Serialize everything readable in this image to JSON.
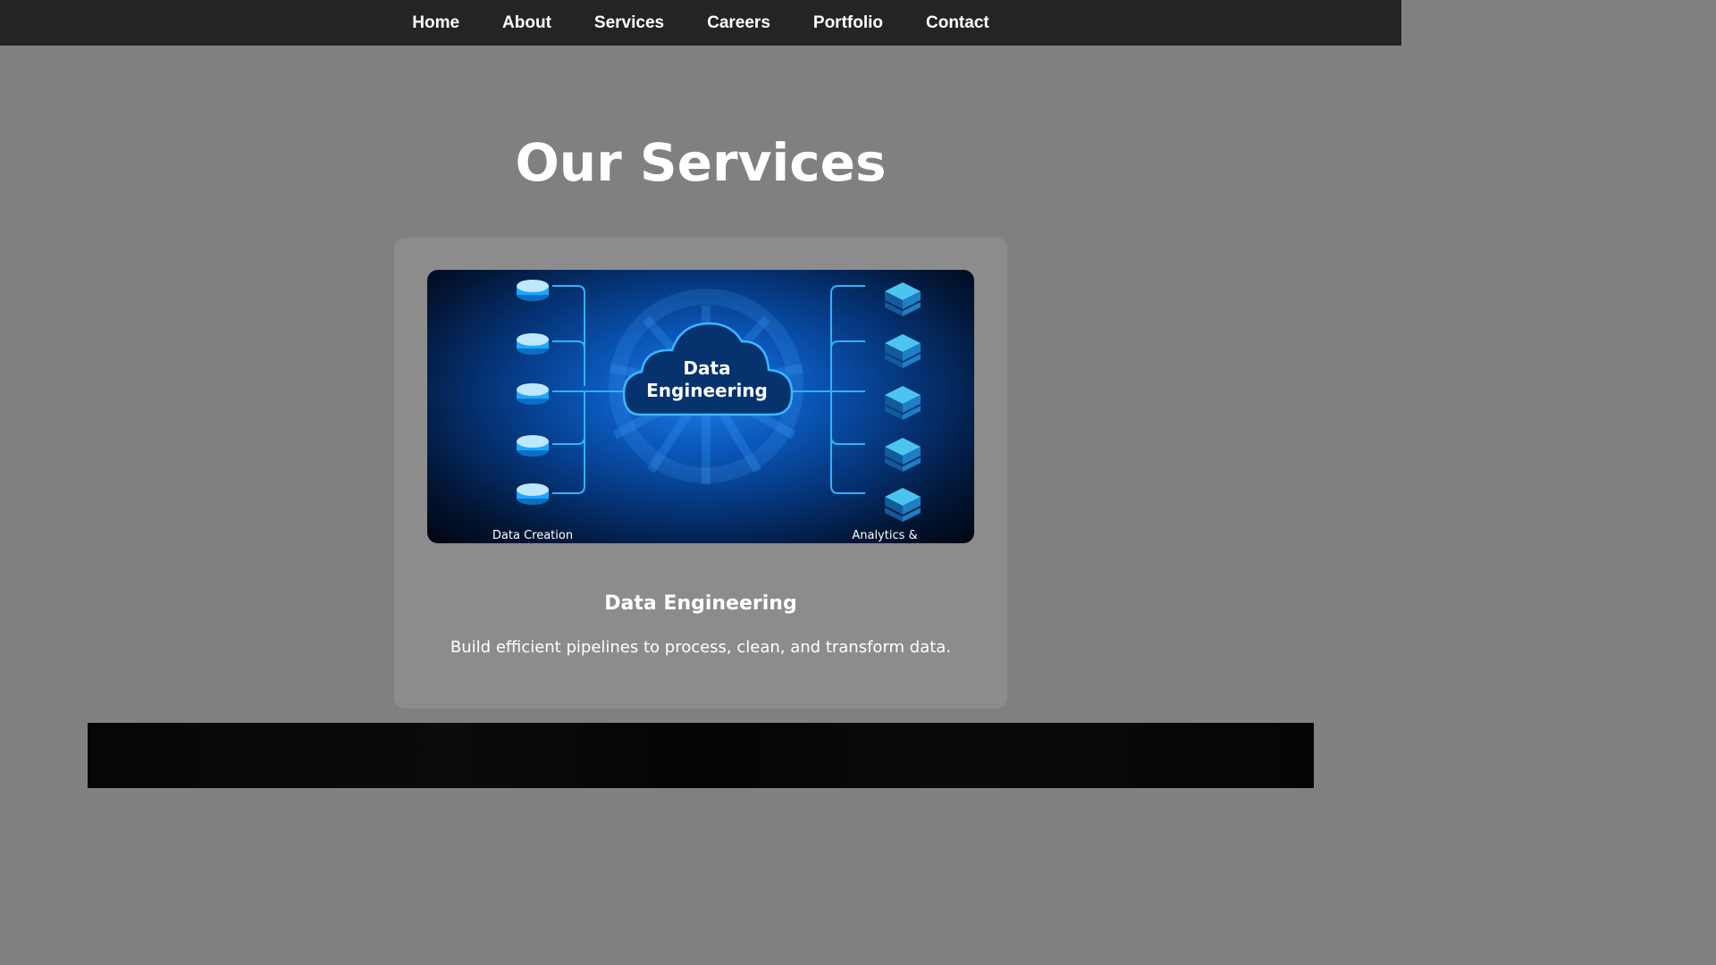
{
  "nav": {
    "items": [
      "Home",
      "About",
      "Services",
      "Careers",
      "Portfolio",
      "Contact"
    ]
  },
  "page": {
    "title": "Our Services"
  },
  "service_card": {
    "image": {
      "cloud_line1": "Data",
      "cloud_line2": "Engineering",
      "left_caption": "Data Creation",
      "right_caption": "Analytics &"
    },
    "heading": "Data Engineering",
    "description": "Build efficient pipelines to process, clean, and transform data."
  },
  "colors": {
    "nav_background": "#242424",
    "page_background": "#808080",
    "card_background": "#8c8c8c",
    "accent_blue": "#1f7fe6"
  }
}
